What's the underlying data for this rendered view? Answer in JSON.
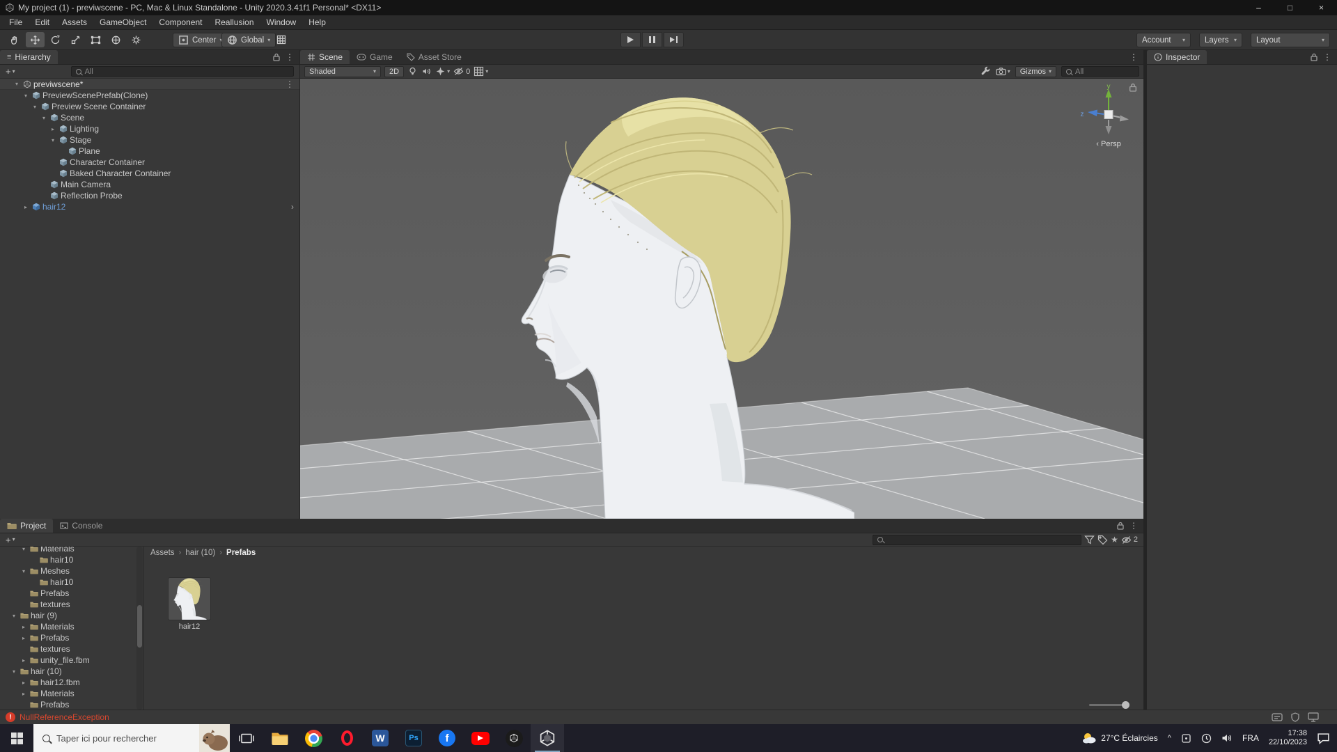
{
  "window": {
    "title": "My project (1) - previwscene - PC, Mac & Linux Standalone - Unity 2020.3.41f1 Personal* <DX11>",
    "minimize": "–",
    "maximize": "□",
    "close": "×"
  },
  "menubar": {
    "items": [
      "File",
      "Edit",
      "Assets",
      "GameObject",
      "Component",
      "Reallusion",
      "Window",
      "Help"
    ]
  },
  "toolbar": {
    "pivot": "Center",
    "space": "Global",
    "account": "Account",
    "layers": "Layers",
    "layout": "Layout"
  },
  "icons": {
    "kebab": "⋮",
    "caret": "▾",
    "chevron_right": "›",
    "star": "★",
    "plus": "+",
    "breadcrumb_sep": "›",
    "tray_chevron": "^"
  },
  "hierarchy": {
    "tab": "Hierarchy",
    "search_filter": "All",
    "rows": [
      {
        "label": "previwscene*",
        "fold": "▾"
      },
      {
        "label": "PreviewScenePrefab(Clone)",
        "fold": "▾"
      },
      {
        "label": "Preview Scene Container",
        "fold": "▾"
      },
      {
        "label": "Scene",
        "fold": "▾"
      },
      {
        "label": "Lighting",
        "fold": "▸"
      },
      {
        "label": "Stage",
        "fold": "▾"
      },
      {
        "label": "Plane",
        "fold": ""
      },
      {
        "label": "Character Container",
        "fold": ""
      },
      {
        "label": "Baked Character Container",
        "fold": ""
      },
      {
        "label": "Main Camera",
        "fold": ""
      },
      {
        "label": "Reflection Probe",
        "fold": ""
      },
      {
        "label": "hair12",
        "fold": "▸"
      }
    ]
  },
  "scene_view": {
    "tabs": [
      "Scene",
      "Game",
      "Asset Store"
    ],
    "shading": "Shaded",
    "mode_2d": "2D",
    "hidden_count": "0",
    "gizmos": "Gizmos",
    "search_filter": "All",
    "axis_y": "y",
    "axis_z": "z",
    "persp_arrow": "‹",
    "persp": "Persp"
  },
  "inspector": {
    "tab": "Inspector"
  },
  "project": {
    "tabs": [
      "Project",
      "Console"
    ],
    "breadcrumb": {
      "root": "Assets",
      "folder": "hair (10)",
      "current": "Prefabs"
    },
    "hidden_count": "2",
    "tree": [
      {
        "label": "Materials",
        "fold": "▾"
      },
      {
        "label": "hair10",
        "fold": ""
      },
      {
        "label": "Meshes",
        "fold": "▾"
      },
      {
        "label": "hair10",
        "fold": ""
      },
      {
        "label": "Prefabs",
        "fold": ""
      },
      {
        "label": "textures",
        "fold": ""
      },
      {
        "label": "hair (9)",
        "fold": "▾"
      },
      {
        "label": "Materials",
        "fold": "▸"
      },
      {
        "label": "Prefabs",
        "fold": "▸"
      },
      {
        "label": "textures",
        "fold": ""
      },
      {
        "label": "unity_file.fbm",
        "fold": "▸"
      },
      {
        "label": "hair (10)",
        "fold": "▾"
      },
      {
        "label": "hair12.fbm",
        "fold": "▸"
      },
      {
        "label": "Materials",
        "fold": "▸"
      },
      {
        "label": "Prefabs",
        "fold": ""
      }
    ],
    "items": [
      {
        "label": "hair12"
      }
    ]
  },
  "statusbar": {
    "error": "NullReferenceException"
  },
  "taskbar": {
    "search_placeholder": "Taper ici pour rechercher",
    "weather": "27°C  Éclaircies",
    "language": "FRA",
    "time": "17:38",
    "date": "22/10/2023"
  },
  "colors": {
    "prefab_text": "#6f9fd8",
    "error": "#d6472f",
    "hair": "#d8d092",
    "skin": "#eef0f3",
    "selection": "#2c5d87"
  }
}
